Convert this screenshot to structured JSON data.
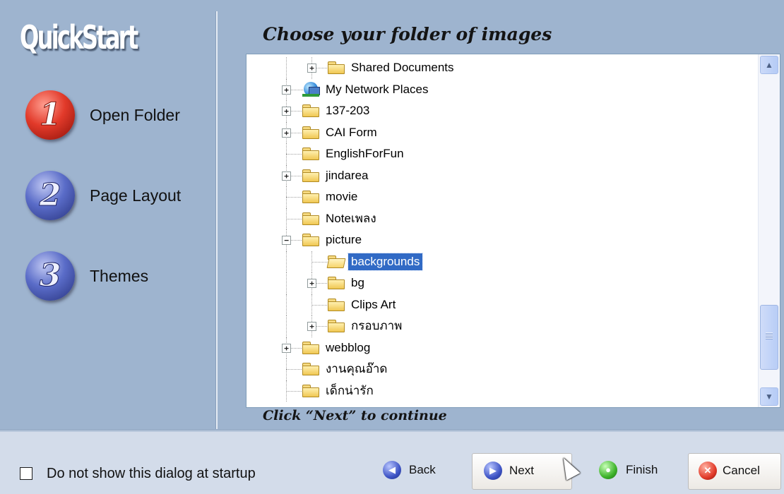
{
  "sidebar": {
    "title": "QuickStart",
    "steps": [
      {
        "number": "1",
        "label": "Open Folder",
        "color": "#e23a2a"
      },
      {
        "number": "2",
        "label": "Page Layout",
        "color": "#5a6cc8"
      },
      {
        "number": "3",
        "label": "Themes",
        "color": "#5a6cc8"
      }
    ]
  },
  "main": {
    "heading": "Choose your folder of images",
    "footer_note": "Click “Next” to continue"
  },
  "tree": {
    "items": [
      {
        "label": "Shared Documents",
        "expander": "+",
        "icon": "folder-icon"
      },
      {
        "label": "My Network Places",
        "expander": "+",
        "icon": "network-places-icon"
      },
      {
        "label": "137-203",
        "expander": "+",
        "icon": "folder-icon"
      },
      {
        "label": "CAI Form",
        "expander": "+",
        "icon": "folder-icon"
      },
      {
        "label": "EnglishForFun",
        "expander": "",
        "icon": "folder-icon"
      },
      {
        "label": "jindarea",
        "expander": "+",
        "icon": "folder-icon"
      },
      {
        "label": "movie",
        "expander": "",
        "icon": "folder-icon"
      },
      {
        "label": "Noteเพลง",
        "expander": "",
        "icon": "folder-icon"
      },
      {
        "label": "picture",
        "expander": "−",
        "icon": "folder-icon"
      },
      {
        "label": "backgrounds",
        "expander": "",
        "icon": "open-folder-icon",
        "selected": true
      },
      {
        "label": "bg",
        "expander": "+",
        "icon": "folder-icon"
      },
      {
        "label": "Clips Art",
        "expander": "",
        "icon": "folder-icon"
      },
      {
        "label": "กรอบภาพ",
        "expander": "+",
        "icon": "folder-icon"
      },
      {
        "label": "webblog",
        "expander": "+",
        "icon": "folder-icon"
      },
      {
        "label": "งานคุณอ๊าด",
        "expander": "",
        "icon": "folder-icon"
      },
      {
        "label": "เด็กน่ารัก",
        "expander": "",
        "icon": "folder-icon"
      }
    ],
    "selection_color": "#316ac5"
  },
  "bottom": {
    "startup_checkbox_label": "Do not show this dialog at startup",
    "startup_checked": false,
    "back_label": "Back",
    "next_label": "Next",
    "finish_label": "Finish",
    "cancel_label": "Cancel"
  }
}
